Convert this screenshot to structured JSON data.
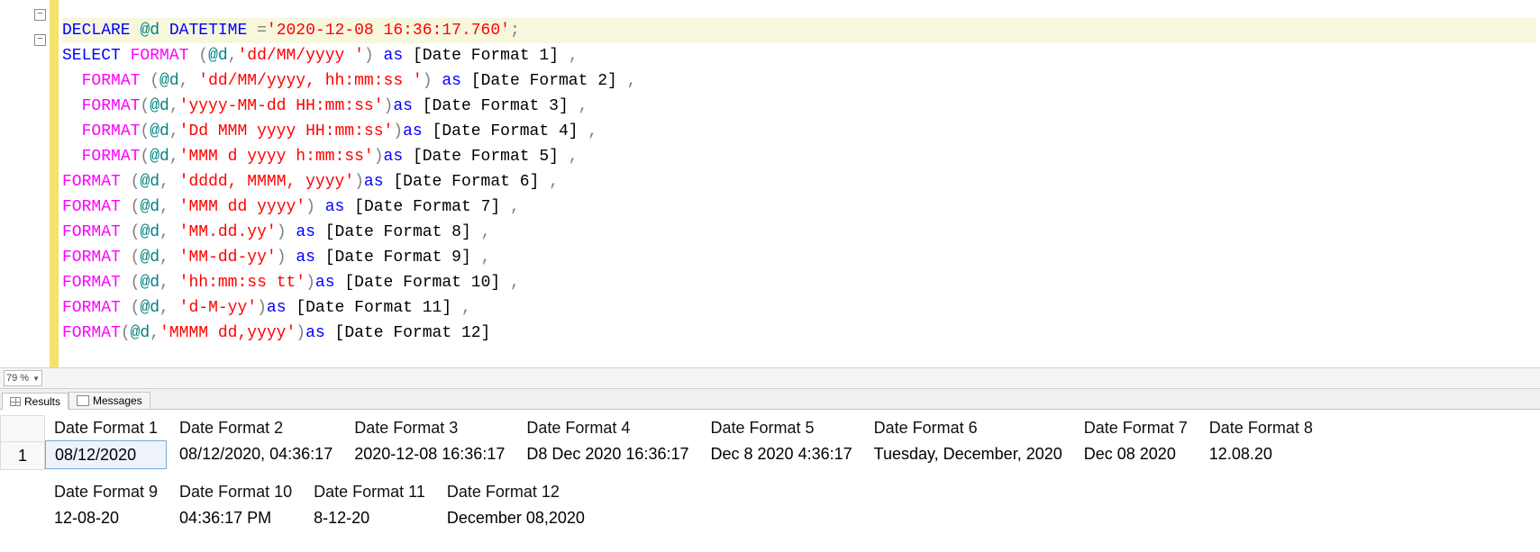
{
  "zoom": "79 %",
  "tabs": {
    "results": "Results",
    "messages": "Messages"
  },
  "code": {
    "declare": "DECLARE",
    "atD": "@d",
    "datetime": "DATETIME",
    "eq": "=",
    "dateLiteral": "'2020-12-08 16:36:17.760'",
    "semicolon": ";",
    "select": "SELECT",
    "format": "FORMAT",
    "as": "as",
    "comma": ",",
    "open": "(",
    "close": ")",
    "formats": [
      {
        "fmt": "'dd/MM/yyyy '",
        "alias": "[Date Format 1]",
        "spaceBeforeParen": true,
        "spaceAfterComma": false,
        "trailingComma": true,
        "indent": "",
        "spaceAfterClose": true
      },
      {
        "fmt": "'dd/MM/yyyy, hh:mm:ss '",
        "alias": "[Date Format 2]",
        "spaceBeforeParen": true,
        "spaceAfterComma": true,
        "trailingComma": true,
        "indent": "  ",
        "spaceAfterClose": true
      },
      {
        "fmt": "'yyyy-MM-dd HH:mm:ss'",
        "alias": "[Date Format 3]",
        "spaceBeforeParen": false,
        "spaceAfterComma": false,
        "trailingComma": true,
        "indent": "  ",
        "spaceAfterClose": false
      },
      {
        "fmt": "'Dd MMM yyyy HH:mm:ss'",
        "alias": "[Date Format 4]",
        "spaceBeforeParen": false,
        "spaceAfterComma": false,
        "trailingComma": true,
        "indent": "  ",
        "spaceAfterClose": false
      },
      {
        "fmt": "'MMM d yyyy h:mm:ss'",
        "alias": "[Date Format 5]",
        "spaceBeforeParen": false,
        "spaceAfterComma": false,
        "trailingComma": true,
        "indent": "  ",
        "spaceAfterClose": false
      },
      {
        "fmt": "'dddd, MMMM, yyyy'",
        "alias": "[Date Format 6]",
        "spaceBeforeParen": true,
        "spaceAfterComma": true,
        "trailingComma": true,
        "indent": "",
        "spaceAfterClose": false
      },
      {
        "fmt": "'MMM dd yyyy'",
        "alias": "[Date Format 7]",
        "spaceBeforeParen": true,
        "spaceAfterComma": true,
        "trailingComma": true,
        "indent": "",
        "spaceAfterClose": true
      },
      {
        "fmt": "'MM.dd.yy'",
        "alias": "[Date Format 8]",
        "spaceBeforeParen": true,
        "spaceAfterComma": true,
        "trailingComma": true,
        "indent": "",
        "spaceAfterClose": true
      },
      {
        "fmt": "'MM-dd-yy'",
        "alias": "[Date Format 9]",
        "spaceBeforeParen": true,
        "spaceAfterComma": true,
        "trailingComma": true,
        "indent": "",
        "spaceAfterClose": true
      },
      {
        "fmt": "'hh:mm:ss tt'",
        "alias": "[Date Format 10]",
        "spaceBeforeParen": true,
        "spaceAfterComma": true,
        "trailingComma": true,
        "indent": "",
        "spaceAfterClose": false
      },
      {
        "fmt": "'d-M-yy'",
        "alias": "[Date Format 11]",
        "spaceBeforeParen": true,
        "spaceAfterComma": true,
        "trailingComma": true,
        "indent": "",
        "spaceAfterClose": false
      },
      {
        "fmt": "'MMMM dd,yyyy'",
        "alias": "[Date Format 12]",
        "spaceBeforeParen": false,
        "spaceAfterComma": false,
        "trailingComma": false,
        "indent": "",
        "spaceAfterClose": false
      }
    ]
  },
  "results": {
    "rowNumber": "1",
    "group1": [
      {
        "header": "Date Format 1",
        "value": "08/12/2020",
        "selected": true
      },
      {
        "header": "Date Format 2",
        "value": "08/12/2020, 04:36:17"
      },
      {
        "header": "Date Format 3",
        "value": "2020-12-08 16:36:17"
      },
      {
        "header": "Date Format 4",
        "value": "D8 Dec 2020 16:36:17"
      },
      {
        "header": "Date Format 5",
        "value": "Dec 8 2020 4:36:17"
      },
      {
        "header": "Date Format 6",
        "value": "Tuesday, December, 2020"
      },
      {
        "header": "Date Format 7",
        "value": "Dec 08 2020"
      },
      {
        "header": "Date Format 8",
        "value": "12.08.20"
      }
    ],
    "group2": [
      {
        "header": "Date Format 9",
        "value": "12-08-20"
      },
      {
        "header": "Date Format 10",
        "value": "04:36:17 PM"
      },
      {
        "header": "Date Format 11",
        "value": "8-12-20"
      },
      {
        "header": "Date Format 12",
        "value": "December 08,2020"
      }
    ]
  }
}
